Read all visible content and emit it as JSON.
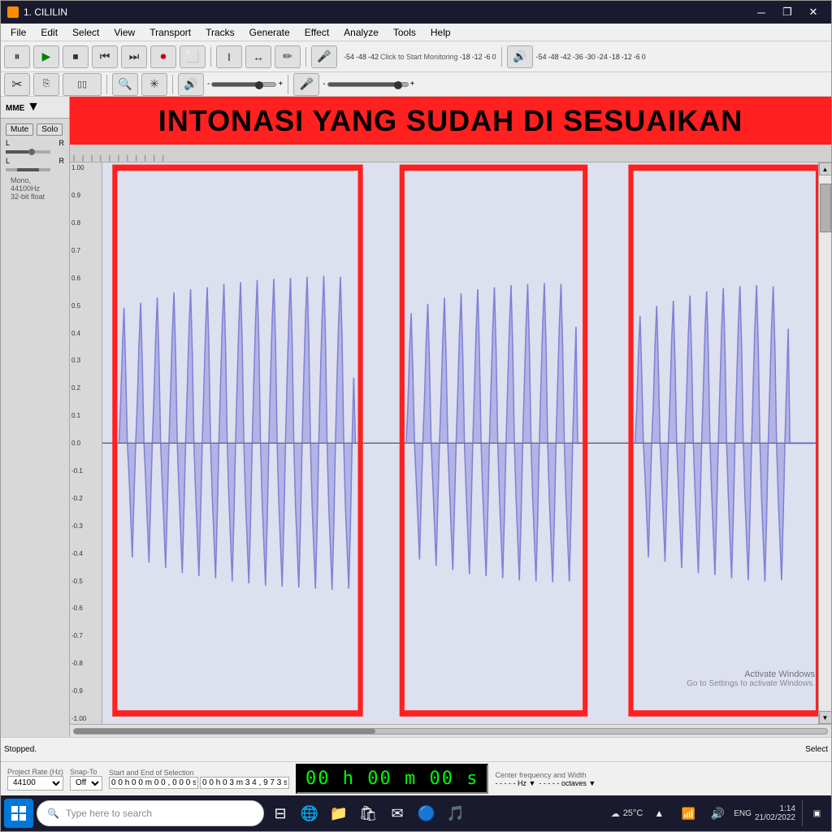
{
  "window": {
    "title": "1. CILILIN",
    "icon": "🎵"
  },
  "menu": {
    "items": [
      "File",
      "Edit",
      "Select",
      "View",
      "Transport",
      "Tracks",
      "Generate",
      "Effect",
      "Analyze",
      "Tools",
      "Help"
    ]
  },
  "toolbar": {
    "buttons": [
      {
        "id": "pause",
        "label": "⏸",
        "name": "pause-button"
      },
      {
        "id": "play",
        "label": "▶",
        "name": "play-button",
        "color": "green"
      },
      {
        "id": "stop",
        "label": "⏹",
        "name": "stop-button"
      },
      {
        "id": "prev",
        "label": "⏮",
        "name": "skip-back-button"
      },
      {
        "id": "next",
        "label": "⏭",
        "name": "skip-forward-button"
      },
      {
        "id": "record",
        "label": "⏺",
        "name": "record-button",
        "color": "red"
      },
      {
        "id": "loop",
        "label": "↺",
        "name": "loop-button"
      }
    ]
  },
  "annotation": {
    "text": "INTONASI YANG SUDAH DI SESUAIKAN"
  },
  "track": {
    "label": "MME",
    "mute": "Mute",
    "solo": "Solo",
    "info": "Mono, 44100Hz\n32-bit float",
    "lr_left": "L",
    "lr_right": "R"
  },
  "meter": {
    "levels": [
      "-54",
      "-48",
      "-42",
      "-36",
      "-30",
      "-24",
      "-18",
      "-12",
      "-6",
      "0"
    ],
    "click_to_start": "Click to Start Monitoring",
    "negative_levels": [
      "-54",
      "-48",
      "-42",
      "-36",
      "-30",
      "-24",
      "-18",
      "-12",
      "-6",
      "0"
    ]
  },
  "statusbar": {
    "project_rate_label": "Project Rate (Hz)",
    "project_rate_value": "44100",
    "snap_to_label": "Snap-To",
    "snap_to_value": "Off",
    "selection_label": "Start and End of Selection",
    "selection_start": "0 0 h 0 0 m 0 0 , 0 0 0 s",
    "selection_end": "0 0 h 0 3 m 3 4 , 9 7 3 s",
    "time_display": "00 h 00 m 00 s",
    "freq_label": "Center frequency and Width",
    "freq_hz": "- - - - - Hz",
    "freq_oct": "- - - - - octaves"
  },
  "taskbar": {
    "search_placeholder": "Type here to search",
    "time": "1:14",
    "date": "21/02/2022",
    "temperature": "25°C",
    "language": "ENG",
    "activate_windows": "Activate Windows",
    "go_to_settings": "Go to Settings to activate Windows."
  },
  "status_bottom": {
    "text": "Stopped.",
    "select_label": "Select"
  },
  "waveform": {
    "y_labels": [
      "1.00",
      "0.9",
      "0.8",
      "0.7",
      "0.6",
      "0.5",
      "0.4",
      "0.3",
      "0.2",
      "0.1",
      "0.0",
      "-0.1",
      "-0.2",
      "-0.3",
      "-0.4",
      "-0.5",
      "-0.6",
      "-0.7",
      "-0.8",
      "-0.9",
      "-1.00"
    ]
  }
}
